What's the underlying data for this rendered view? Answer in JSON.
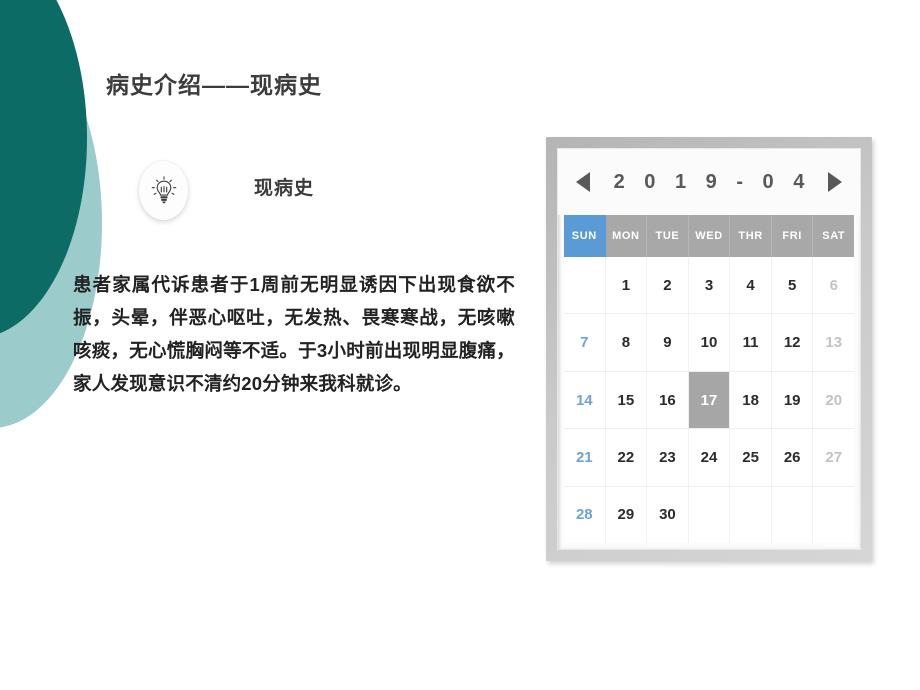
{
  "slide": {
    "title": "病史介绍——现病史",
    "section_label": "现病史",
    "body_text": "患者家属代诉患者于1周前无明显诱因下出现食欲不振，头晕，伴恶心呕吐，无发热、畏寒寒战，无咳嗽咳痰，无心慌胸闷等不适。于3小时前出现明显腹痛，家人发现意识不清约20分钟来我科就诊。"
  },
  "colors": {
    "teal_dark": "#0D6B66",
    "teal_light": "#9CCBCB",
    "calendar_sunday_blue": "#5B9BD5",
    "calendar_weekday_gray": "#A8A8A8",
    "calendar_today_gray": "#A6A6A6",
    "title_text": "#3C3C3C",
    "body_text": "#222222",
    "background": "#FFFFFF"
  },
  "calendar": {
    "title": "2 0 1 9 - 0 4",
    "year": "2019",
    "month": "04",
    "prev_label": "◀",
    "next_label": "▶",
    "weekdays": [
      "SUN",
      "MON",
      "TUE",
      "WED",
      "THR",
      "FRI",
      "SAT"
    ],
    "selected_day": "17",
    "rows": [
      [
        {
          "label": "",
          "type": "empty"
        },
        {
          "label": "1",
          "type": "weekday"
        },
        {
          "label": "2",
          "type": "weekday"
        },
        {
          "label": "3",
          "type": "weekday"
        },
        {
          "label": "4",
          "type": "weekday"
        },
        {
          "label": "5",
          "type": "weekday"
        },
        {
          "label": "6",
          "type": "saturday"
        }
      ],
      [
        {
          "label": "7",
          "type": "sunday"
        },
        {
          "label": "8",
          "type": "weekday"
        },
        {
          "label": "9",
          "type": "weekday"
        },
        {
          "label": "10",
          "type": "weekday"
        },
        {
          "label": "11",
          "type": "weekday"
        },
        {
          "label": "12",
          "type": "weekday"
        },
        {
          "label": "13",
          "type": "saturday"
        }
      ],
      [
        {
          "label": "14",
          "type": "sunday"
        },
        {
          "label": "15",
          "type": "weekday"
        },
        {
          "label": "16",
          "type": "weekday"
        },
        {
          "label": "17",
          "type": "today"
        },
        {
          "label": "18",
          "type": "weekday"
        },
        {
          "label": "19",
          "type": "weekday"
        },
        {
          "label": "20",
          "type": "saturday"
        }
      ],
      [
        {
          "label": "21",
          "type": "sunday"
        },
        {
          "label": "22",
          "type": "weekday"
        },
        {
          "label": "23",
          "type": "weekday"
        },
        {
          "label": "24",
          "type": "weekday"
        },
        {
          "label": "25",
          "type": "weekday"
        },
        {
          "label": "26",
          "type": "weekday"
        },
        {
          "label": "27",
          "type": "saturday"
        }
      ],
      [
        {
          "label": "28",
          "type": "sunday"
        },
        {
          "label": "29",
          "type": "weekday"
        },
        {
          "label": "30",
          "type": "weekday"
        },
        {
          "label": "",
          "type": "empty"
        },
        {
          "label": "",
          "type": "empty"
        },
        {
          "label": "",
          "type": "empty"
        },
        {
          "label": "",
          "type": "empty"
        }
      ]
    ]
  },
  "icons": {
    "bulb": "lightbulb-icon",
    "prev": "arrow-left-icon",
    "next": "arrow-right-icon"
  }
}
